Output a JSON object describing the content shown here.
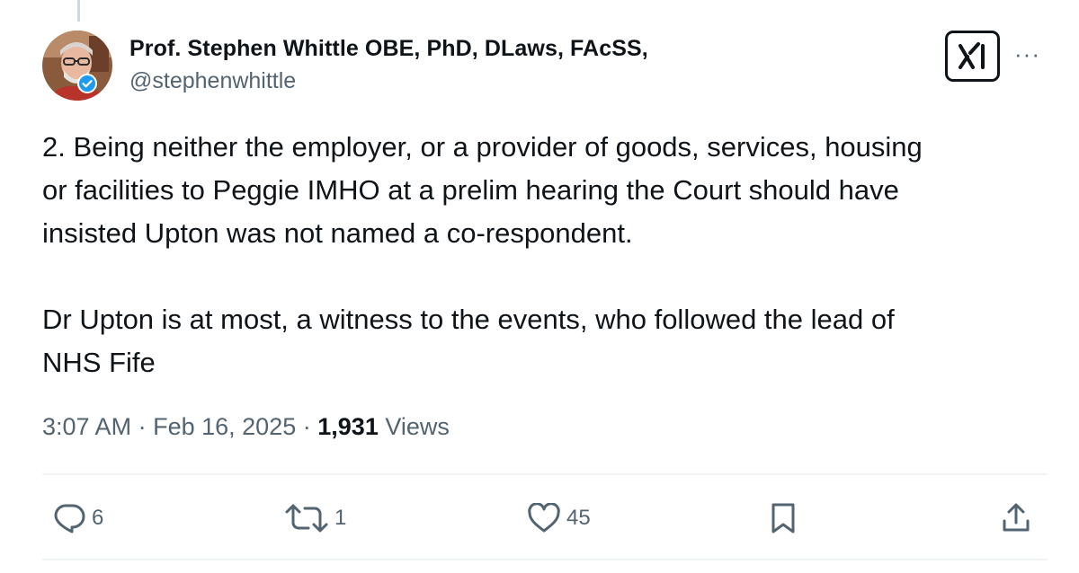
{
  "tweet": {
    "author": {
      "display_name": "Prof. Stephen Whittle OBE, PhD, DLaws, FAcSS,",
      "handle": "@stephenwhittle",
      "verified": true
    },
    "text": "2. Being neither the employer, or a provider of goods, services, housing\nor facilities to Peggie IMHO at a prelim hearing the Court should have\ninsisted Upton was not named a co-respondent.\n\nDr Upton is at most, a witness to the events, who followed the lead of\nNHS Fife",
    "meta": {
      "time": "3:07 AM",
      "separator": "·",
      "date": "Feb 16, 2025",
      "views_count": "1,931",
      "views_label": "Views"
    },
    "actions": {
      "replies": "6",
      "reposts": "1",
      "likes": "45"
    }
  },
  "icons": {
    "grok": "grok-icon",
    "more": "more-icon",
    "reply": "reply-icon",
    "repost": "repost-icon",
    "like": "heart-icon",
    "bookmark": "bookmark-icon",
    "share": "share-icon",
    "verified": "verified-badge-icon"
  },
  "colors": {
    "text": "#0f1419",
    "secondary": "#536471",
    "divider": "#eff3f4",
    "verified": "#1d9bf0"
  }
}
